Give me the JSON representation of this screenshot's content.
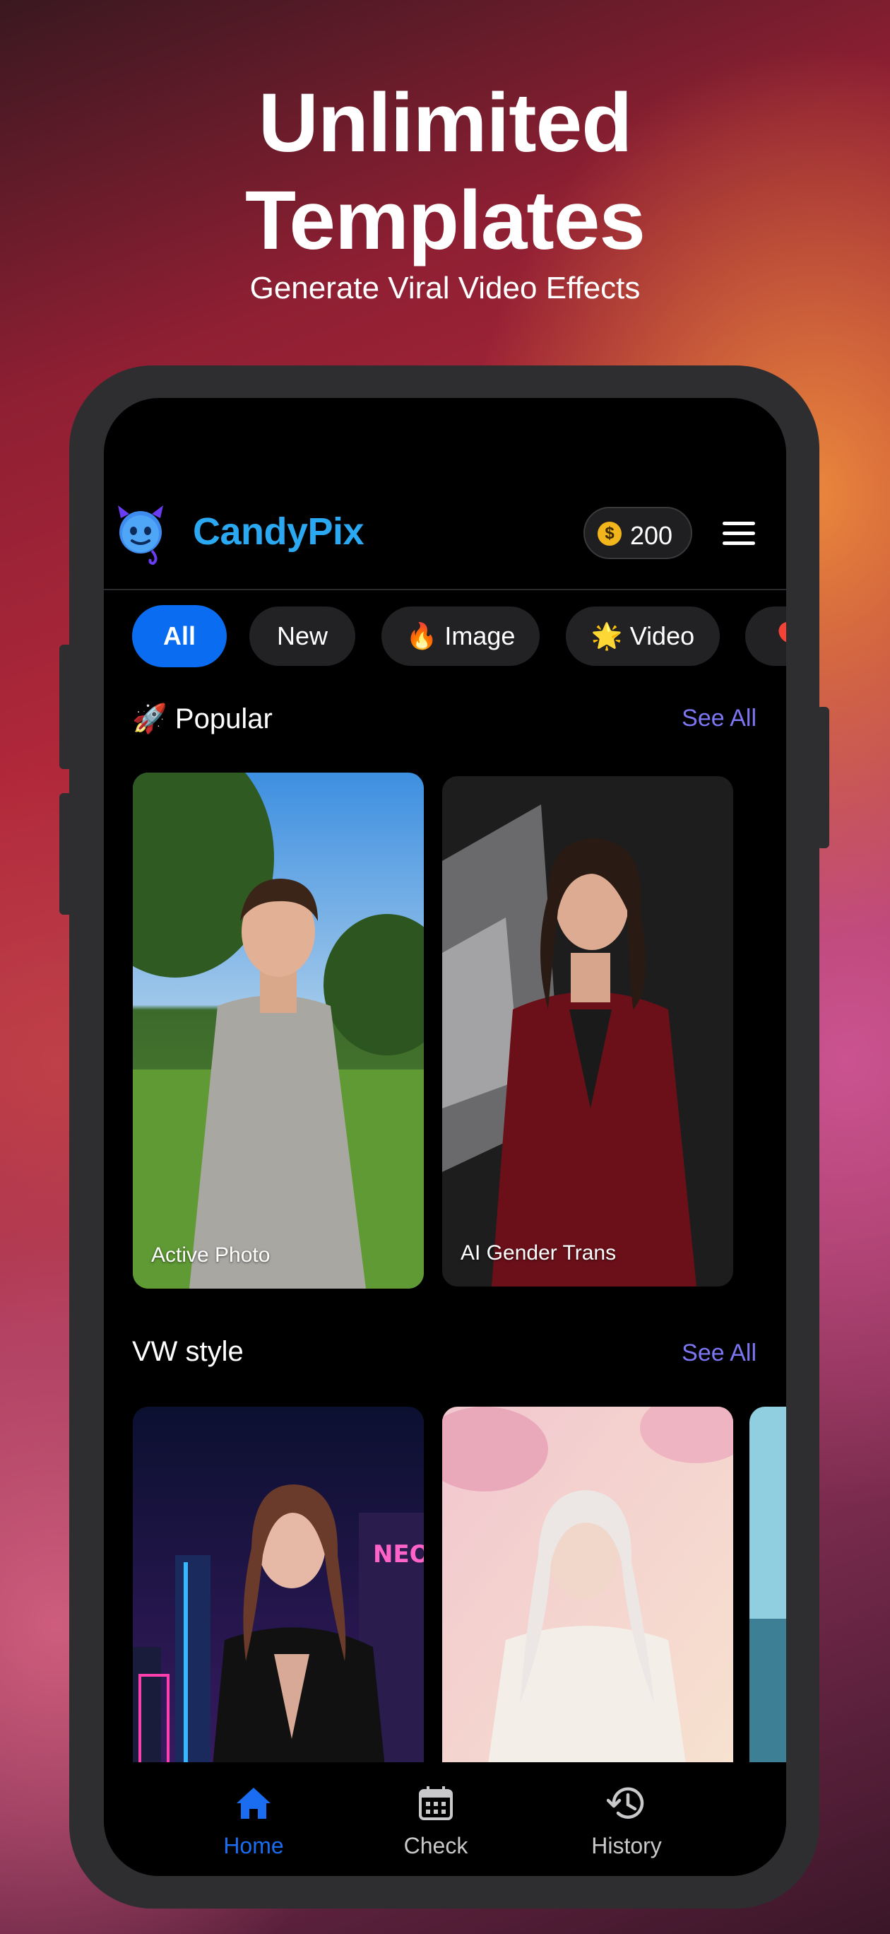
{
  "hero": {
    "title_line1": "Unlimited",
    "title_line2": "Templates",
    "subtitle": "Generate Viral Video Effects"
  },
  "app": {
    "name": "CandyPix",
    "coin_balance": "200",
    "logo_icon": "devil-mascot-icon",
    "menu_icon": "hamburger-menu-icon"
  },
  "filters": [
    {
      "label": "All",
      "active": true
    },
    {
      "label": "New",
      "active": false
    },
    {
      "label": "🔥 Image",
      "active": false
    },
    {
      "label": "🌟 Video",
      "active": false
    },
    {
      "label": "🎈",
      "active": false
    }
  ],
  "sections": [
    {
      "title": "🚀 Popular",
      "see_all": "See All",
      "cards": [
        {
          "label": "Active Photo"
        },
        {
          "label": "AI Gender Trans"
        }
      ]
    },
    {
      "title": "VW style",
      "see_all": "See All",
      "cards": [
        {
          "label": ""
        },
        {
          "label": ""
        }
      ]
    }
  ],
  "nav": [
    {
      "label": "Home",
      "icon": "home-icon",
      "active": true
    },
    {
      "label": "Check",
      "icon": "calendar-icon",
      "active": false
    },
    {
      "label": "History",
      "icon": "history-icon",
      "active": false
    }
  ],
  "colors": {
    "brand": "#2aa8f2",
    "accent": "#0a6cf0",
    "link": "#7d76f3",
    "nav_active": "#1a6cf0",
    "nav_inactive": "#c9c9cc"
  }
}
